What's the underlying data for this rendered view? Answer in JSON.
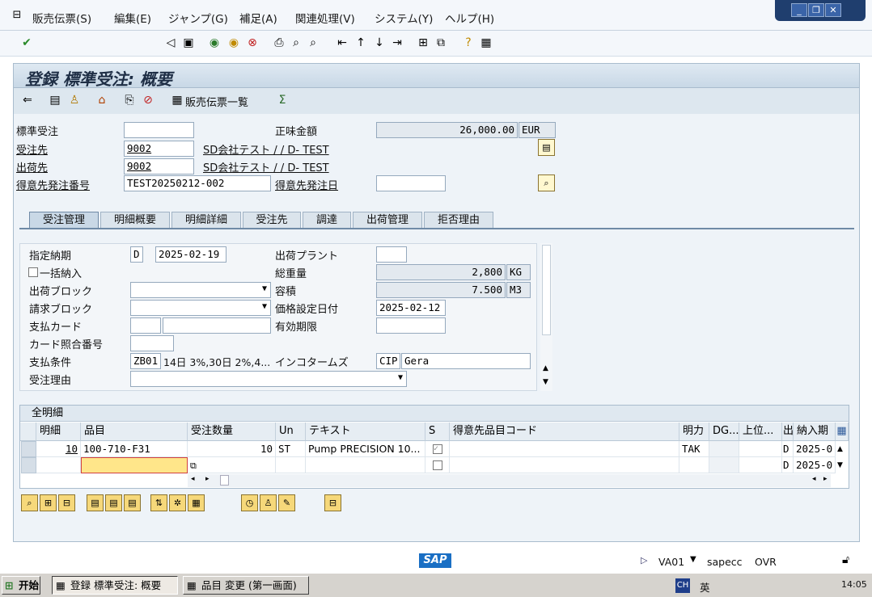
{
  "menu": {
    "items": [
      "販売伝票(S)",
      "編集(E)",
      "ジャンプ(G)",
      "補足(A)",
      "関連処理(V)",
      "システム(Y)",
      "ヘルプ(H)"
    ]
  },
  "title": "登録 標準受注: 概要",
  "app_toolbar": {
    "doc_list_label": "販売伝票一覧"
  },
  "header": {
    "std_order_label": "標準受注",
    "std_order_value": "",
    "net_value_label": "正味金額",
    "net_value": "26,000.00",
    "currency": "EUR",
    "sold_to_label": "受注先",
    "sold_to_value": "9002",
    "sold_to_name": "SD会社テスト / / D- TEST",
    "ship_to_label": "出荷先",
    "ship_to_value": "9002",
    "ship_to_name": "SD会社テスト / / D- TEST",
    "po_number_label": "得意先発注番号",
    "po_number_value": "TEST20250212-002",
    "po_date_label": "得意先発注日",
    "po_date_value": ""
  },
  "tabs": [
    "受注管理",
    "明細概要",
    "明細詳細",
    "受注先",
    "調達",
    "出荷管理",
    "拒否理由"
  ],
  "form": {
    "req_delivery_label": "指定納期",
    "req_delivery_type": "D",
    "req_delivery_date": "2025-02-19",
    "complete_delivery_label": "一括納入",
    "delivery_block_label": "出荷ブロック",
    "billing_block_label": "請求ブロック",
    "payment_card_label": "支払カード",
    "card_ref_label": "カード照合番号",
    "payment_terms_label": "支払条件",
    "payment_terms_code": "ZB01",
    "payment_terms_text": "14日 3%,30日 2%,4...",
    "order_reason_label": "受注理由",
    "plant_label": "出荷プラント",
    "plant_value": "",
    "total_weight_label": "総重量",
    "total_weight": "2,800",
    "weight_unit": "KG",
    "volume_label": "容積",
    "volume": "7.500",
    "volume_unit": "M3",
    "pricing_date_label": "価格設定日付",
    "pricing_date": "2025-02-12",
    "valid_to_label": "有効期限",
    "valid_to": "",
    "incoterms_label": "インコタームズ",
    "incoterms_code": "CIP",
    "incoterms_place": "Gera"
  },
  "grid": {
    "title": "全明細",
    "columns": [
      "明細",
      "品目",
      "受注数量",
      "Un",
      "テキスト",
      "S",
      "得意先品目コード",
      "明力",
      "DG...",
      "上位...",
      "出",
      "納入期"
    ],
    "rows": [
      {
        "item": "10",
        "material": "100-710-F31",
        "qty": "10",
        "unit": "ST",
        "text": "Pump PRECISION 10...",
        "cat": "TAK",
        "d": "D",
        "date": "2025-0"
      },
      {
        "item": "",
        "material": "",
        "qty": "",
        "unit": "",
        "text": "",
        "cat": "",
        "d": "D",
        "date": "2025-0"
      }
    ]
  },
  "status": {
    "tcode": "VA01",
    "server": "sapecc",
    "mode": "OVR",
    "logo": "SAP"
  },
  "taskbar": {
    "start": "开始",
    "task1": "登録 標準受注: 概要",
    "task2": "品目 変更 (第一画面)",
    "ime": "CH",
    "lang": "英",
    "time": "14:05"
  },
  "colors": {
    "titlebar": "#c8d8e6",
    "tab_active": "#c9d8e6",
    "input_highlight": "#ffe68a",
    "win_ctl": "#1f3e6e"
  }
}
